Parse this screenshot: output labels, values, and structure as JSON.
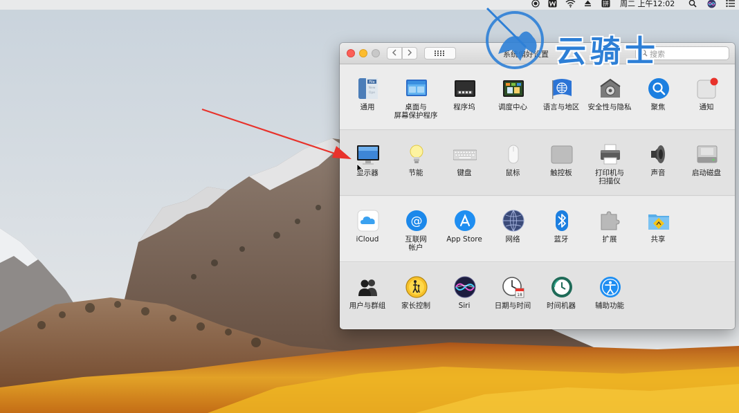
{
  "menubar": {
    "datetime": "周二 上午12:02"
  },
  "watermark": {
    "text": "云骑士"
  },
  "window": {
    "title": "系统偏好设置",
    "search_placeholder": "搜索"
  },
  "sections": [
    {
      "items": [
        {
          "id": "general",
          "label": "通用",
          "icon": "general-icon"
        },
        {
          "id": "desktop",
          "label": "桌面与\n屏幕保护程序",
          "icon": "desktop-screensaver-icon"
        },
        {
          "id": "dock",
          "label": "程序坞",
          "icon": "dock-icon"
        },
        {
          "id": "mission",
          "label": "调度中心",
          "icon": "mission-control-icon"
        },
        {
          "id": "language",
          "label": "语言与地区",
          "icon": "language-region-icon"
        },
        {
          "id": "security",
          "label": "安全性与隐私",
          "icon": "security-privacy-icon"
        },
        {
          "id": "spotlight",
          "label": "聚焦",
          "icon": "spotlight-icon"
        },
        {
          "id": "notify",
          "label": "通知",
          "icon": "notifications-icon"
        }
      ]
    },
    {
      "items": [
        {
          "id": "displays",
          "label": "显示器",
          "icon": "displays-icon"
        },
        {
          "id": "energy",
          "label": "节能",
          "icon": "energy-saver-icon"
        },
        {
          "id": "keyboard",
          "label": "键盘",
          "icon": "keyboard-icon"
        },
        {
          "id": "mouse",
          "label": "鼠标",
          "icon": "mouse-icon"
        },
        {
          "id": "trackpad",
          "label": "触控板",
          "icon": "trackpad-icon"
        },
        {
          "id": "printers",
          "label": "打印机与\n扫描仪",
          "icon": "printer-scanner-icon"
        },
        {
          "id": "sound",
          "label": "声音",
          "icon": "sound-icon"
        },
        {
          "id": "startup",
          "label": "启动磁盘",
          "icon": "startup-disk-icon"
        }
      ]
    },
    {
      "items": [
        {
          "id": "icloud",
          "label": "iCloud",
          "icon": "icloud-icon"
        },
        {
          "id": "internet",
          "label": "互联网\n帐户",
          "icon": "internet-accounts-icon"
        },
        {
          "id": "appstore",
          "label": "App Store",
          "icon": "app-store-icon"
        },
        {
          "id": "network",
          "label": "网络",
          "icon": "network-icon"
        },
        {
          "id": "bluetooth",
          "label": "蓝牙",
          "icon": "bluetooth-icon"
        },
        {
          "id": "extensions",
          "label": "扩展",
          "icon": "extensions-icon"
        },
        {
          "id": "sharing",
          "label": "共享",
          "icon": "sharing-icon"
        }
      ]
    },
    {
      "items": [
        {
          "id": "users",
          "label": "用户与群组",
          "icon": "users-groups-icon"
        },
        {
          "id": "parental",
          "label": "家长控制",
          "icon": "parental-controls-icon"
        },
        {
          "id": "siri",
          "label": "Siri",
          "icon": "siri-icon"
        },
        {
          "id": "datetime",
          "label": "日期与时间",
          "icon": "date-time-icon"
        },
        {
          "id": "timemachine",
          "label": "时间机器",
          "icon": "time-machine-icon"
        },
        {
          "id": "access",
          "label": "辅助功能",
          "icon": "accessibility-icon"
        }
      ]
    }
  ],
  "colors": {
    "close": "#fc5f57",
    "minimize": "#fdbc2e",
    "arrow": "#e8322b",
    "watermark": "#2d7fd6"
  }
}
